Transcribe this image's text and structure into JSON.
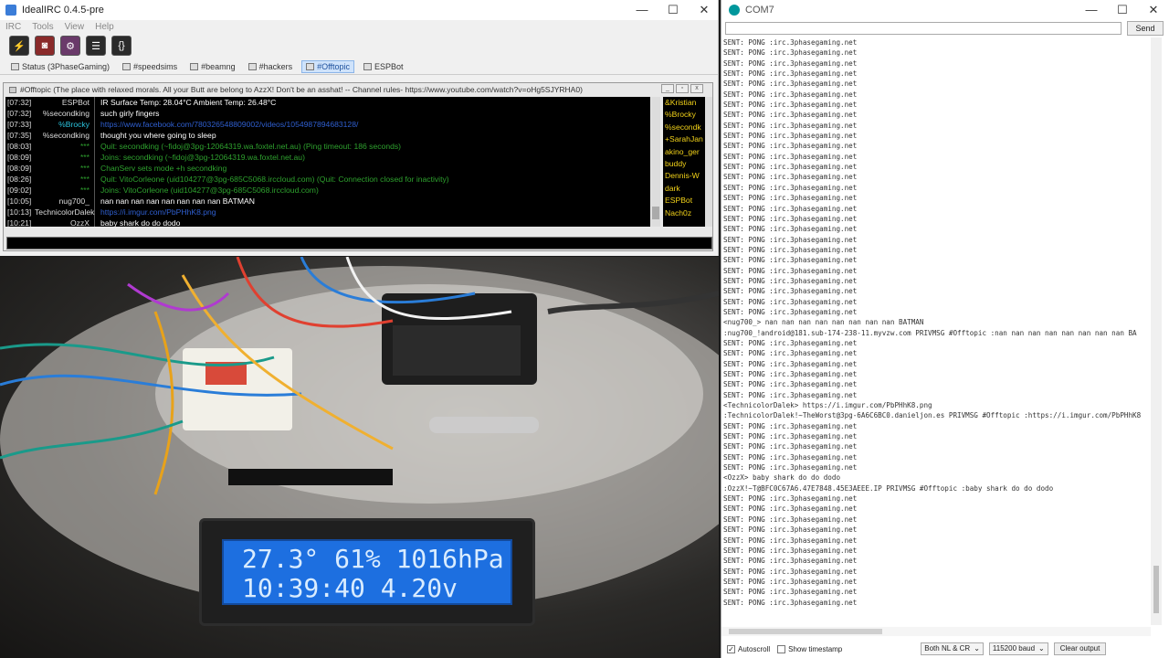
{
  "irc": {
    "title": "IdealIRC 0.4.5-pre",
    "menu": [
      "IRC",
      "Tools",
      "View",
      "Help"
    ],
    "window_controls": [
      "—",
      "☐",
      "✕"
    ],
    "tabs": [
      {
        "label": "Status (3PhaseGaming)"
      },
      {
        "label": "#speedsims"
      },
      {
        "label": "#beamng"
      },
      {
        "label": "#hackers"
      },
      {
        "label": "#Offtopic",
        "active": true
      },
      {
        "label": "ESPBot"
      }
    ],
    "channel_topic": "#Offtopic (The place with relaxed morals. All your Butt are belong to AzzX! Don't be an asshat! -- Channel rules- https://www.youtube.com/watch?v=oHg5SJYRHA0)",
    "messages": [
      {
        "ts": "[07:32]",
        "nick": "ESPBot",
        "text": "IR Surface Temp: 28.04°C Ambient Temp: 26.48°C",
        "kind": "normal"
      },
      {
        "ts": "[07:32]",
        "nick": "%secondking",
        "text": "such girly fingers",
        "kind": "normal"
      },
      {
        "ts": "[07:33]",
        "nick": "%Brocky",
        "text": "https://www.facebook.com/780326548809002/videos/1054987894683128/",
        "kind": "link-hl"
      },
      {
        "ts": "[07:35]",
        "nick": "%secondking",
        "text": "thought you where going to sleep",
        "kind": "normal"
      },
      {
        "ts": "[08:03]",
        "nick": "***",
        "text": "Quit: secondking (~fidoj@3pg-12064319.wa.foxtel.net.au) (Ping timeout: 186 seconds)",
        "kind": "sys"
      },
      {
        "ts": "[08:09]",
        "nick": "***",
        "text": "Joins: secondking (~fidoj@3pg-12064319.wa.foxtel.net.au)",
        "kind": "sys"
      },
      {
        "ts": "[08:09]",
        "nick": "***",
        "text": "ChanServ sets mode +h secondking",
        "kind": "sys"
      },
      {
        "ts": "[08:26]",
        "nick": "***",
        "text": "Quit: VitoCorleone (uid104277@3pg-685C5068.irccloud.com) (Quit: Connection closed for inactivity)",
        "kind": "sys"
      },
      {
        "ts": "[09:02]",
        "nick": "***",
        "text": "Joins: VitoCorleone (uid104277@3pg-685C5068.irccloud.com)",
        "kind": "sys"
      },
      {
        "ts": "[10:05]",
        "nick": "nug700_",
        "text": "nan nan nan nan nan nan nan nan BATMAN",
        "kind": "normal"
      },
      {
        "ts": "[10:13]",
        "nick": "TechnicolorDalek",
        "text": "https://i.imgur.com/PbPHhK8.png",
        "kind": "link"
      },
      {
        "ts": "[10:21]",
        "nick": "OzzX",
        "text": "baby shark do do dodo",
        "kind": "normal"
      }
    ],
    "nicklist": [
      "&Kristian",
      "%Brocky",
      "%secondk",
      "+SarahJan",
      "akino_ger",
      "buddy",
      "Dennis-W",
      "dark",
      "ESPBot",
      "Nach0z"
    ]
  },
  "lcd": {
    "line1": "27.3° 61% 1016hPa",
    "line2": "10:39:40 4.20v"
  },
  "serial": {
    "title": "COM7",
    "send_label": "Send",
    "log": [
      "SENT: PONG :irc.3phasegaming.net",
      "SENT: PONG :irc.3phasegaming.net",
      "SENT: PONG :irc.3phasegaming.net",
      "SENT: PONG :irc.3phasegaming.net",
      "SENT: PONG :irc.3phasegaming.net",
      "SENT: PONG :irc.3phasegaming.net",
      "SENT: PONG :irc.3phasegaming.net",
      "SENT: PONG :irc.3phasegaming.net",
      "SENT: PONG :irc.3phasegaming.net",
      "SENT: PONG :irc.3phasegaming.net",
      "SENT: PONG :irc.3phasegaming.net",
      "SENT: PONG :irc.3phasegaming.net",
      "SENT: PONG :irc.3phasegaming.net",
      "SENT: PONG :irc.3phasegaming.net",
      "SENT: PONG :irc.3phasegaming.net",
      "SENT: PONG :irc.3phasegaming.net",
      "SENT: PONG :irc.3phasegaming.net",
      "SENT: PONG :irc.3phasegaming.net",
      "SENT: PONG :irc.3phasegaming.net",
      "SENT: PONG :irc.3phasegaming.net",
      "SENT: PONG :irc.3phasegaming.net",
      "SENT: PONG :irc.3phasegaming.net",
      "SENT: PONG :irc.3phasegaming.net",
      "SENT: PONG :irc.3phasegaming.net",
      "SENT: PONG :irc.3phasegaming.net",
      "SENT: PONG :irc.3phasegaming.net",
      "SENT: PONG :irc.3phasegaming.net",
      "<nug700_> nan nan nan nan nan nan nan nan BATMAN",
      ":nug700_!android@181.sub-174-238-11.myvzw.com PRIVMSG #Offtopic :nan nan nan nan nan nan nan nan BA",
      "SENT: PONG :irc.3phasegaming.net",
      "SENT: PONG :irc.3phasegaming.net",
      "SENT: PONG :irc.3phasegaming.net",
      "SENT: PONG :irc.3phasegaming.net",
      "SENT: PONG :irc.3phasegaming.net",
      "SENT: PONG :irc.3phasegaming.net",
      "<TechnicolorDalek> https://i.imgur.com/PbPHhK8.png",
      ":TechnicolorDalek!~TheWorst@3pg-6A6C6BC0.danieljon.es PRIVMSG #Offtopic :https://i.imgur.com/PbPHhK8",
      "SENT: PONG :irc.3phasegaming.net",
      "SENT: PONG :irc.3phasegaming.net",
      "SENT: PONG :irc.3phasegaming.net",
      "SENT: PONG :irc.3phasegaming.net",
      "SENT: PONG :irc.3phasegaming.net",
      "<OzzX> baby shark do do dodo",
      ":OzzX!~T@BFC0C67A6.47E7848.45E3AEEE.IP PRIVMSG #Offtopic :baby shark do do dodo",
      "SENT: PONG :irc.3phasegaming.net",
      "SENT: PONG :irc.3phasegaming.net",
      "SENT: PONG :irc.3phasegaming.net",
      "SENT: PONG :irc.3phasegaming.net",
      "SENT: PONG :irc.3phasegaming.net",
      "SENT: PONG :irc.3phasegaming.net",
      "SENT: PONG :irc.3phasegaming.net",
      "SENT: PONG :irc.3phasegaming.net",
      "SENT: PONG :irc.3phasegaming.net",
      "SENT: PONG :irc.3phasegaming.net",
      "SENT: PONG :irc.3phasegaming.net"
    ],
    "autoscroll_label": "Autoscroll",
    "autoscroll_checked": true,
    "timestamp_label": "Show timestamp",
    "timestamp_checked": false,
    "line_ending": "Both NL & CR",
    "baud": "115200 baud",
    "clear_label": "Clear output"
  }
}
